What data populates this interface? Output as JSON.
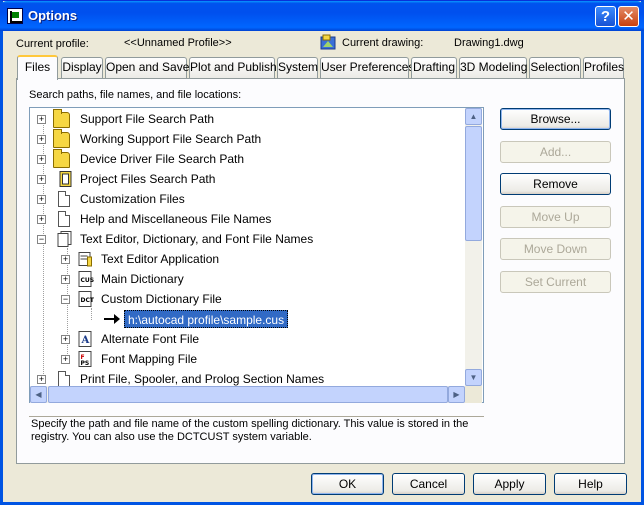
{
  "window": {
    "title": "Options"
  },
  "header": {
    "profile_label": "Current profile:",
    "profile_value": "<<Unnamed Profile>>",
    "drawing_label": "Current drawing:",
    "drawing_value": "Drawing1.dwg"
  },
  "tabs": [
    {
      "label": "Files",
      "active": true
    },
    {
      "label": "Display"
    },
    {
      "label": "Open and Save"
    },
    {
      "label": "Plot and Publish"
    },
    {
      "label": "System"
    },
    {
      "label": "User Preferences"
    },
    {
      "label": "Drafting"
    },
    {
      "label": "3D Modeling"
    },
    {
      "label": "Selection"
    },
    {
      "label": "Profiles"
    }
  ],
  "files": {
    "section_label": "Search paths, file names, and file locations:",
    "tree": [
      {
        "label": "Support File Search Path",
        "icon": "folder-icon"
      },
      {
        "label": "Working Support File Search Path",
        "icon": "folder-icon"
      },
      {
        "label": "Device Driver File Search Path",
        "icon": "folder-icon"
      },
      {
        "label": "Project Files Search Path",
        "icon": "project-icon"
      },
      {
        "label": "Customization Files",
        "icon": "document-icon"
      },
      {
        "label": "Help and Miscellaneous File Names",
        "icon": "document-icon"
      },
      {
        "label": "Text Editor, Dictionary, and Font File Names",
        "icon": "documents-icon",
        "expanded": true
      },
      {
        "label": "Text Editor Application",
        "icon": "text-editor-icon"
      },
      {
        "label": "Main Dictionary",
        "icon": "dictionary-icon"
      },
      {
        "label": "Custom Dictionary File",
        "icon": "custom-dictionary-icon",
        "expanded": true
      },
      {
        "label": "h:\\autocad profile\\sample.cus",
        "selected": true
      },
      {
        "label": "Alternate Font File",
        "icon": "font-icon"
      },
      {
        "label": "Font Mapping File",
        "icon": "font-mapping-icon"
      },
      {
        "label": "Print File, Spooler, and Prolog Section Names",
        "icon": "document-icon"
      }
    ],
    "description": "Specify the path and file name of the custom spelling dictionary. This value is stored in the registry. You can also use the DCTCUST system variable."
  },
  "side_buttons": {
    "browse": "Browse...",
    "add": "Add...",
    "remove": "Remove",
    "move_up": "Move Up",
    "move_down": "Move Down",
    "set_current": "Set Current"
  },
  "footer": {
    "ok": "OK",
    "cancel": "Cancel",
    "apply": "Apply",
    "help": "Help"
  },
  "colors": {
    "titlebar": "#0054e3",
    "selection": "#316ac5",
    "active_tab_accent": "#ffc83c"
  }
}
